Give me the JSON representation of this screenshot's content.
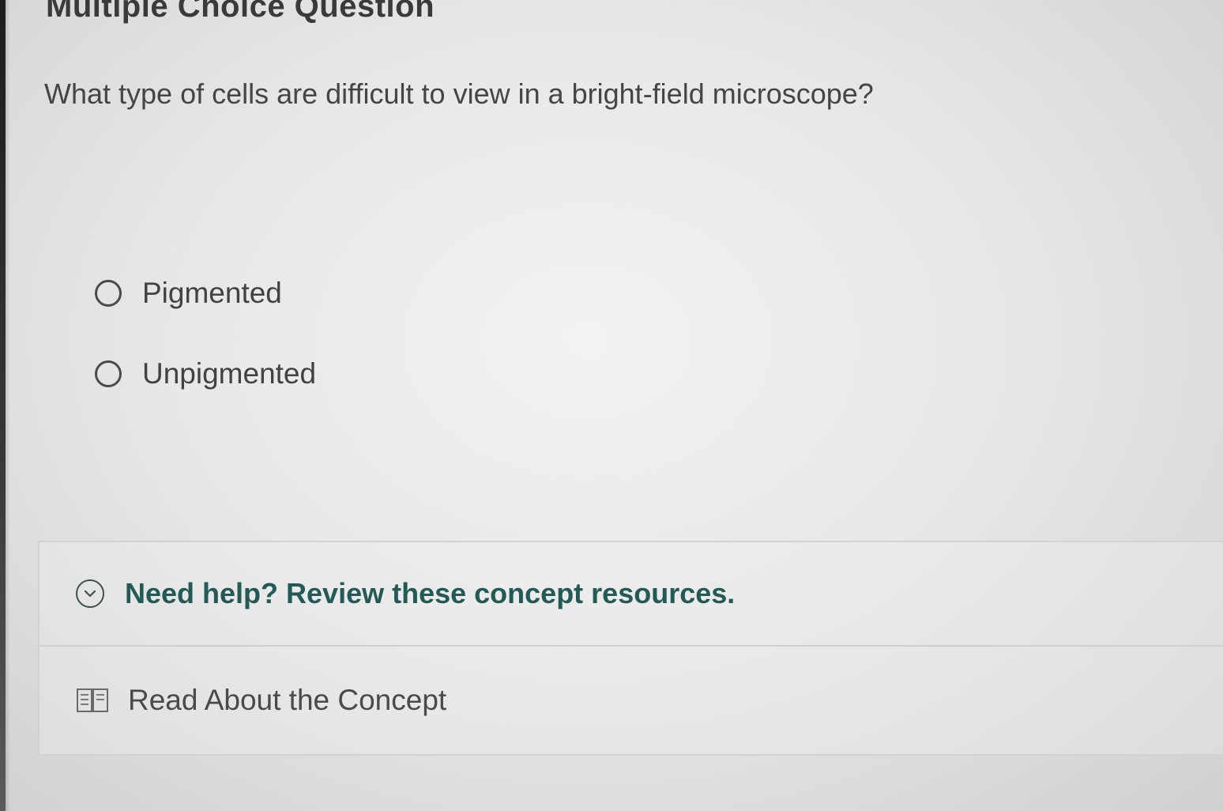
{
  "page": {
    "heading": "Multiple Choice Question",
    "question": "What type of cells are difficult to view in a bright-field microscope?"
  },
  "options": [
    {
      "label": "Pigmented",
      "selected": false
    },
    {
      "label": "Unpigmented",
      "selected": false
    }
  ],
  "help": {
    "toggle_label": "Need help? Review these concept resources.",
    "toggle_icon": "chevron-down-circle-icon",
    "resources": [
      {
        "label": "Read About the Concept",
        "icon": "book-icon"
      }
    ]
  },
  "colors": {
    "help_text": "#245a55",
    "body_text": "#424242"
  }
}
